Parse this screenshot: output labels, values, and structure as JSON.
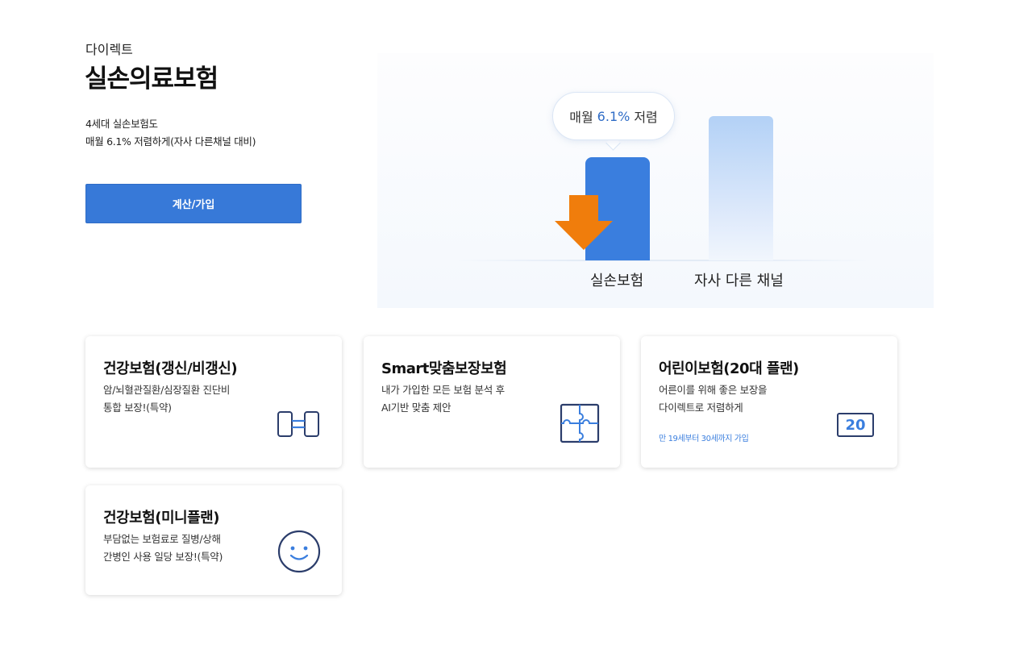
{
  "hero": {
    "subtitle": "다이렉트",
    "title": "실손의료보험",
    "desc_line1": "4세대 실손보험도",
    "desc_line2": "매월 6.1% 저렴하게(자사 다른채널 대비)",
    "cta_label": "계산/가입"
  },
  "graphic": {
    "bubble_pre": "매월",
    "bubble_value": "6.1%",
    "bubble_post": "저렴",
    "bar_label_1": "실손보험",
    "bar_label_2": "자사 다른 채널",
    "accent_blue": "#3a7ede",
    "arrow_orange": "#f07d0c"
  },
  "cards": [
    {
      "title": "건강보험(갱신/비갱신)",
      "line1": "암/뇌혈관질환/심장질환 진단비",
      "line2": "통합 보장!(특약)",
      "icon": "dumbbell-icon"
    },
    {
      "title": "Smart맞춤보장보험",
      "line1": "내가 가입한 모든 보험 분석 후",
      "line2": "AI기반 맞춤 제안",
      "icon": "puzzle-icon"
    },
    {
      "title": "어린이보험(20대 플랜)",
      "line1": "어른이를 위해 좋은 보장을",
      "line2": "다이렉트로 저렴하게",
      "note": "만 19세부터 30세까지 가입",
      "icon": "twenty-badge-icon",
      "icon_text": "20"
    },
    {
      "title": "건강보험(미니플랜)",
      "line1": "부담없는 보험료로 질병/상해",
      "line2": "간병인 사용 일당 보장!(특약)",
      "icon": "smiley-icon"
    }
  ],
  "colors": {
    "primary": "#3779d8",
    "icon_navy": "#2b3d6b",
    "icon_blue": "#3a7ede"
  }
}
